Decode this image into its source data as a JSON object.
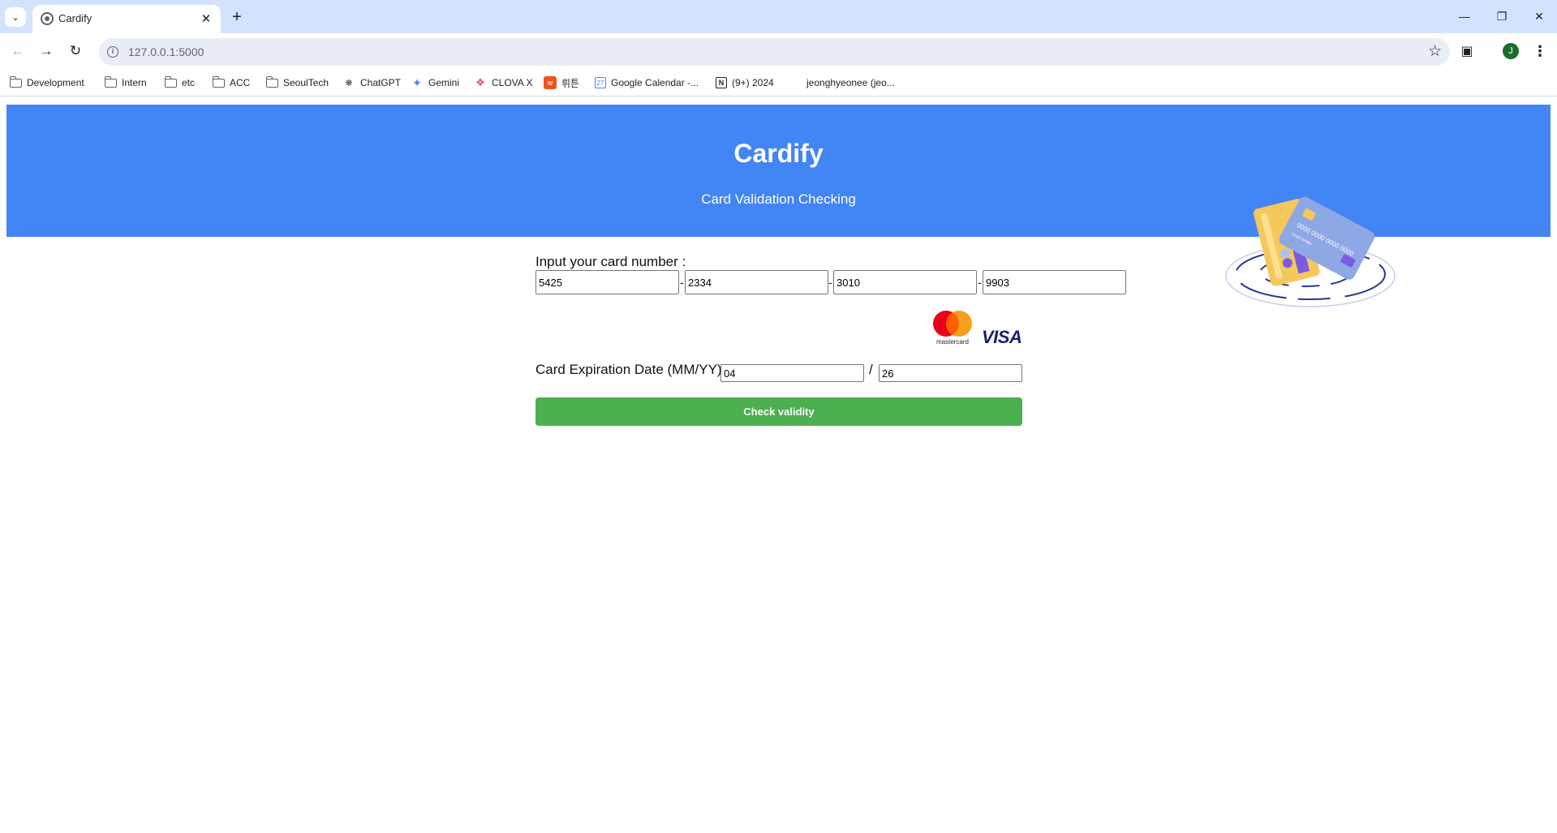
{
  "browser": {
    "tab_title": "Cardify",
    "url": "127.0.0.1:5000",
    "profile_initial": "J",
    "bookmarks": [
      {
        "label": "Development",
        "icon": "folder-icon"
      },
      {
        "label": "Intern",
        "icon": "folder-icon"
      },
      {
        "label": "etc",
        "icon": "folder-icon"
      },
      {
        "label": "ACC",
        "icon": "folder-icon"
      },
      {
        "label": "SeoulTech",
        "icon": "folder-icon"
      },
      {
        "label": "ChatGPT",
        "icon": "chatgpt-icon"
      },
      {
        "label": "Gemini",
        "icon": "gemini-icon"
      },
      {
        "label": "CLOVA X",
        "icon": "clova-icon"
      },
      {
        "label": "뤼튼",
        "icon": "wrtn-icon"
      },
      {
        "label": "Google Calendar -...",
        "icon": "calendar-icon"
      },
      {
        "label": "(9+) 2024",
        "icon": "notion-icon"
      },
      {
        "label": "jeonghyeonee (jeo...",
        "icon": "github-icon"
      }
    ]
  },
  "header": {
    "title": "Cardify",
    "subtitle": "Card Validation Checking"
  },
  "card_form": {
    "card_number_label": "Input your card number :",
    "card_number_parts": [
      "5425",
      "2334",
      "3010",
      "9903"
    ],
    "separator": "-",
    "mastercard_text": "mastercard",
    "visa_text": "VISA",
    "expiry_label": "Card Expiration Date (MM/YY):",
    "expiry_month": "04",
    "expiry_separator": "/",
    "expiry_year": "26",
    "submit_label": "Check validity"
  },
  "colors": {
    "header_bg": "#4285f4",
    "button_bg": "#4caf50",
    "tabbar_bg": "#d3e3fd"
  }
}
